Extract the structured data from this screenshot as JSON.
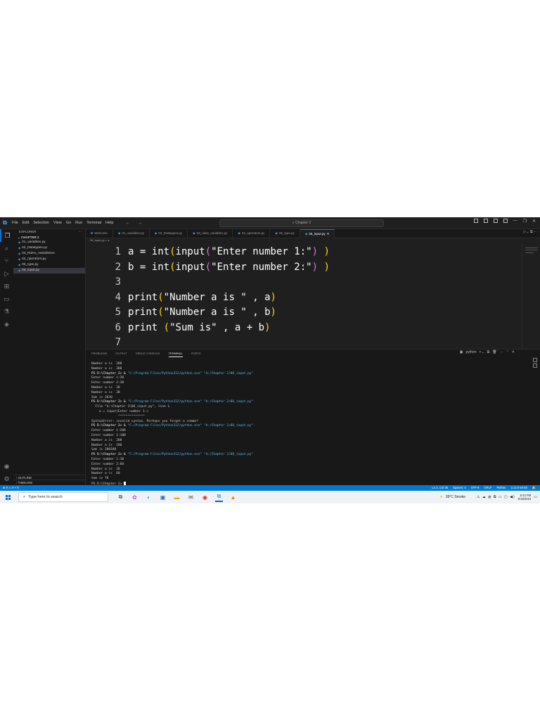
{
  "titlebar": {
    "menus": [
      "File",
      "Edit",
      "Selection",
      "View",
      "Go",
      "Run",
      "Terminal",
      "Help"
    ],
    "nav": "← →",
    "search": "Chapter 2"
  },
  "sidebar": {
    "header": "EXPLORER",
    "folder": "CHAPTER 2",
    "files": [
      "01_variables.py",
      "02_Datatypes.py",
      "03_Rules_Variablesre",
      "04_operators.py",
      "05_type.py",
      "06_input.py"
    ],
    "outline": "OUTLINE",
    "timeline": "TIMELINE"
  },
  "tabs": [
    "Welcome",
    "01_variables.py",
    "02_Datatypes.py",
    "03_rules_variables.py",
    "04_operators.py",
    "05_type.py",
    "06_input.py"
  ],
  "breadcrumb": "06_input.py > a",
  "code": [
    {
      "n": "1",
      "text": "a = int(input(\"Enter number 1:\") )"
    },
    {
      "n": "2",
      "text": "b = int(input(\"Enter number 2:\") )"
    },
    {
      "n": "3",
      "text": ""
    },
    {
      "n": "4",
      "text": "print(\"Number a is \" , a)"
    },
    {
      "n": "5",
      "text": "print(\"Number a is \" , b)"
    },
    {
      "n": "6",
      "text": "print (\"Sum is\" , a + b)"
    },
    {
      "n": "7",
      "text": ""
    }
  ],
  "panel": {
    "tabs": [
      "PROBLEMS",
      "OUTPUT",
      "DEBUG CONSOLE",
      "TERMINAL",
      "PORTS"
    ],
    "active_tab": "TERMINAL",
    "shell": "python"
  },
  "terminal": [
    "Number a is  200",
    "Number a is  300",
    "PS D:\\Chapter 2> & \"C:/Program Files/Python312/python.exe\" \"d:/Chapter 2/06_input.py\"",
    "Enter number 1:20",
    "Enter number 2:30",
    "Number a is  20",
    "Number a is  30",
    "Sum is 2030",
    "PS D:\\Chapter 2> & \"C:/Program Files/Python312/python.exe\" \"d:/Chapter 2/06_input.py\"",
    "  File \"d:\\Chapter 2\\06_input.py\", line 1",
    "    a = input(Enter number 1:)",
    "              ^^^^^^^^^^^^^^",
    "SyntaxError: invalid syntax. Perhaps you forgot a comma?",
    "PS D:\\Chapter 2> & \"C:/Program Files/Python312/python.exe\" \"d:/Chapter 2/06_input.py\"",
    "Enter number 1:200",
    "Enter number 2:100",
    "Number a is  200",
    "Number a is  100",
    "Sum is 200100",
    "PS D:\\Chapter 2> & \"C:/Program Files/Python312/python.exe\" \"d:/Chapter 2/06_input.py\"",
    "Enter number 1:10",
    "Enter number 2:60",
    "Number a is  10",
    "Number a is  60",
    "Sum is 70",
    "PS D:\\Chapter 2> "
  ],
  "statusbar": {
    "left": "⊗ 0 ⚠ 0   ⑂ 0",
    "position": "Ln 2, Col 35",
    "spaces": "Spaces: 4",
    "encoding": "UTF-8",
    "eol": "CRLF",
    "language": "Python",
    "interpreter": "3.12.0 64-bit"
  },
  "taskbar": {
    "search_placeholder": "Type here to search",
    "weather": "28°C  Smoke",
    "time": "8:43 PM",
    "date": "6/18/2024"
  }
}
